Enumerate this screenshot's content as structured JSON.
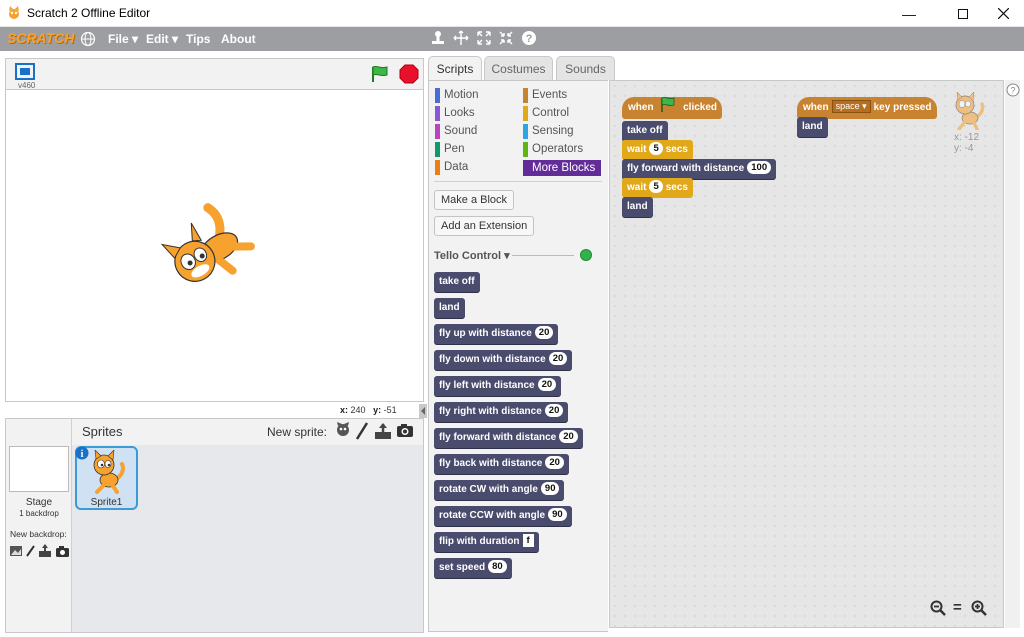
{
  "window": {
    "title": "Scratch 2 Offline Editor"
  },
  "menu": {
    "logo": "SCRATCH",
    "file": "File",
    "edit": "Edit",
    "tips": "Tips",
    "about": "About"
  },
  "stage_header": {
    "version": "v460"
  },
  "stage_coords": {
    "x_label": "x:",
    "x_value": "240",
    "y_label": "y:",
    "y_value": "-51"
  },
  "sprites_pane": {
    "title": "Sprites",
    "new_sprite_label": "New sprite:",
    "stage_label": "Stage",
    "stage_backdrops": "1 backdrop",
    "new_backdrop_label": "New backdrop:",
    "sprite1_name": "Sprite1"
  },
  "tabs": [
    "Scripts",
    "Costumes",
    "Sounds"
  ],
  "categories": {
    "left": [
      {
        "label": "Motion",
        "color": "#4a6cd4"
      },
      {
        "label": "Looks",
        "color": "#8a55d7"
      },
      {
        "label": "Sound",
        "color": "#bb42c3"
      },
      {
        "label": "Pen",
        "color": "#0e9a6c"
      },
      {
        "label": "Data",
        "color": "#ee7d16"
      }
    ],
    "right": [
      {
        "label": "Events",
        "color": "#c88330"
      },
      {
        "label": "Control",
        "color": "#e1a91a"
      },
      {
        "label": "Sensing",
        "color": "#2ca5e2"
      },
      {
        "label": "Operators",
        "color": "#5cb712"
      },
      {
        "label": "More Blocks",
        "color": "#632d99"
      }
    ]
  },
  "palette": {
    "make_block": "Make a Block",
    "add_extension": "Add an Extension",
    "extension_name": "Tello Control",
    "blocks": [
      {
        "text": "take off"
      },
      {
        "text": "land"
      },
      {
        "text": "fly up with distance",
        "arg": "20"
      },
      {
        "text": "fly down with distance",
        "arg": "20"
      },
      {
        "text": "fly left with distance",
        "arg": "20"
      },
      {
        "text": "fly right with distance",
        "arg": "20"
      },
      {
        "text": "fly forward with distance",
        "arg": "20"
      },
      {
        "text": "fly back with distance",
        "arg": "20"
      },
      {
        "text": "rotate CW with angle",
        "arg": "90"
      },
      {
        "text": "rotate CCW with angle",
        "arg": "90"
      },
      {
        "text": "flip with duration",
        "arg": "f",
        "square": true
      },
      {
        "text": "set speed",
        "arg": "80"
      }
    ]
  },
  "script1": {
    "hat_when": "when",
    "hat_clicked": "clicked",
    "take_off": "take off",
    "wait1_pre": "wait",
    "wait1_arg": "5",
    "wait1_post": "secs",
    "fly_forward": "fly forward with distance",
    "fly_forward_arg": "100",
    "wait2_pre": "wait",
    "wait2_arg": "5",
    "wait2_post": "secs",
    "land": "land"
  },
  "script2": {
    "hat_when": "when",
    "key": "space",
    "hat_post": "key pressed",
    "land": "land"
  },
  "sprite_info": {
    "x_label": "x:",
    "x_value": "-12",
    "y_label": "y:",
    "y_value": "-4"
  },
  "zoom": {
    "equal": "="
  }
}
